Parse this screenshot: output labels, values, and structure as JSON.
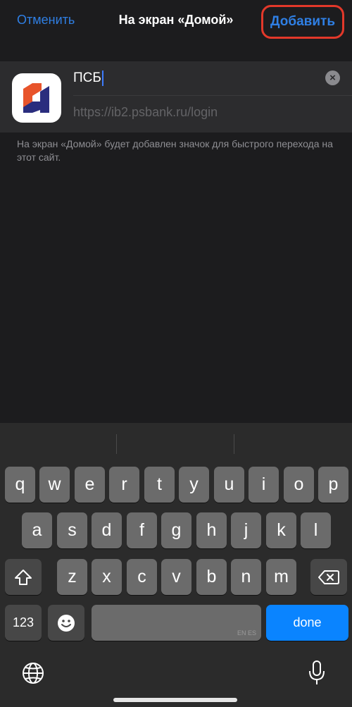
{
  "navbar": {
    "cancel_label": "Отменить",
    "title": "На экран «Домой»",
    "add_label": "Добавить"
  },
  "bookmark": {
    "name_value": "ПСБ",
    "url": "https://ib2.psbank.ru/login",
    "icon": "psb-logo-icon"
  },
  "footnote": "На экран «Домой» будет добавлен значок для быстрого перехода на этот сайт.",
  "keyboard": {
    "row1": [
      "q",
      "w",
      "e",
      "r",
      "t",
      "y",
      "u",
      "i",
      "o",
      "p"
    ],
    "row2": [
      "a",
      "s",
      "d",
      "f",
      "g",
      "h",
      "j",
      "k",
      "l"
    ],
    "row3": [
      "z",
      "x",
      "c",
      "v",
      "b",
      "n",
      "m"
    ],
    "numbers_label": "123",
    "space_hint": "EN ES",
    "done_label": "done",
    "icons": [
      "shift-icon",
      "backspace-icon",
      "emoji-icon",
      "globe-icon",
      "microphone-icon"
    ]
  },
  "colors": {
    "accent": "#2f7fe4",
    "highlight_border": "#e2382a",
    "done_key": "#0a84ff"
  }
}
